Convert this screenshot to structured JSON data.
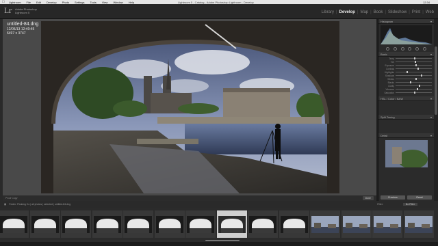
{
  "menubar": {
    "items": [
      "Lightroom",
      "File",
      "Edit",
      "Develop",
      "Photo",
      "Settings",
      "Tools",
      "View",
      "Window",
      "Help"
    ],
    "window_title": "Lightroom 5 - Catalog - Adobe Photoshop Lightroom - Develop",
    "status": "12:34"
  },
  "identity": {
    "logo": "Lr",
    "product": "Adobe Photoshop",
    "version": "Lightroom 5"
  },
  "modules": {
    "library": "Library",
    "develop": "Develop",
    "map": "Map",
    "book": "Book",
    "slideshow": "Slideshow",
    "print": "Print",
    "web": "Web",
    "sep": "|",
    "active": "Develop"
  },
  "photo_info": {
    "filename": "untitled-84.dng",
    "datetime": "12/05/13 12:40:45",
    "dimensions": "6497 x 3747"
  },
  "toolbar": {
    "left": "Proof Copy",
    "right": "Done"
  },
  "right_panel": {
    "histogram_label": "Histogram",
    "basic_label": "Basic",
    "sliders": [
      "Temp",
      "Tint",
      "Exposure",
      "Contrast",
      "Highlights",
      "Shadows",
      "Whites",
      "Blacks",
      "Clarity",
      "Vibrance",
      "Saturation"
    ],
    "hsl_label": "HSL / Color / B&W",
    "split_label": "Split Toning",
    "detail_label": "Detail",
    "previous": "Previous",
    "reset": "Reset"
  },
  "filmstrip": {
    "breadcrumb": "Folder: Peaking Co  |  all photos  |  selected  |  untitled-84.dng",
    "filter_label": "Filter:",
    "filter_value": "No Filter",
    "selected_index": 7,
    "count": 14
  },
  "colors": {
    "background": "#1e1e1e",
    "panel": "#2b2b2b",
    "workspace": "#494949",
    "selected_thumb": "#cfcfcf"
  }
}
